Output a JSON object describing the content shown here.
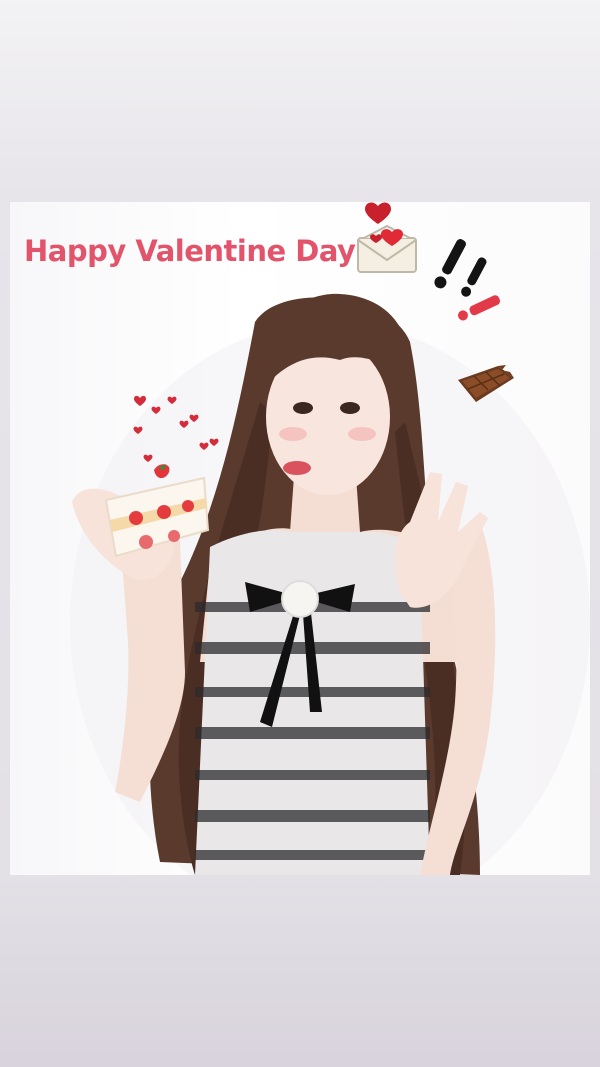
{
  "story": {
    "greeting_text": "Happy Valentine Day",
    "accent_color": "#e2546c",
    "stickers": [
      "love-letter-icon",
      "double-exclamation-icon",
      "chocolate-bar-icon",
      "floating-hearts-icon"
    ],
    "photo_subject": "woman-holding-strawberry-cake"
  }
}
